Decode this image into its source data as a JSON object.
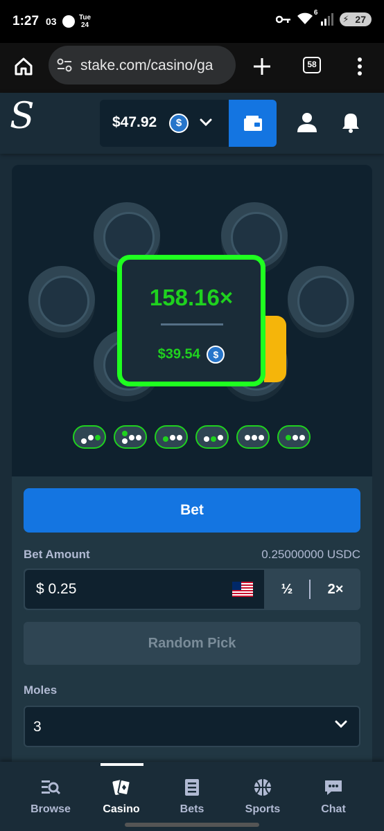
{
  "status_bar": {
    "time": "1:27",
    "notification_count": "03",
    "day_short": "Tue",
    "day_num": "24",
    "wifi_badge": "6",
    "battery": "27"
  },
  "browser": {
    "url": "stake.com/casino/ga",
    "tab_count": "58"
  },
  "header": {
    "logo_letter": "S",
    "balance": "$47.92",
    "currency_icon": "usdc-coin-icon"
  },
  "game": {
    "multiplier": "158.16×",
    "payout": "$39.54",
    "history_pills": [
      {
        "green": [
          1
        ]
      },
      {
        "green": [
          0
        ]
      },
      {
        "green": [
          0
        ]
      },
      {
        "green": [
          2
        ]
      },
      {
        "green": []
      },
      {
        "green": [
          0
        ]
      }
    ],
    "colors": {
      "win": "#1fd11f",
      "border": "#1fff20",
      "accent": "#f5b50a"
    }
  },
  "controls": {
    "bet_button": "Bet",
    "bet_amount_label": "Bet Amount",
    "bet_amount_crypto": "0.25000000 USDC",
    "currency_symbol": "$",
    "bet_amount_value": "0.25",
    "half_label": "½",
    "double_label": "2×",
    "random_pick_label": "Random Pick",
    "moles_label": "Moles",
    "moles_value": "3"
  },
  "bottom_nav": {
    "items": [
      {
        "label": "Browse",
        "icon": "browse-icon"
      },
      {
        "label": "Casino",
        "icon": "casino-cards-icon",
        "active": true
      },
      {
        "label": "Bets",
        "icon": "bets-list-icon"
      },
      {
        "label": "Sports",
        "icon": "basketball-icon"
      },
      {
        "label": "Chat",
        "icon": "chat-bubble-icon"
      }
    ]
  },
  "theme": {
    "primary": "#1475e1",
    "bg": "#1a2c38",
    "panel": "#213743",
    "input": "#0f212e"
  }
}
